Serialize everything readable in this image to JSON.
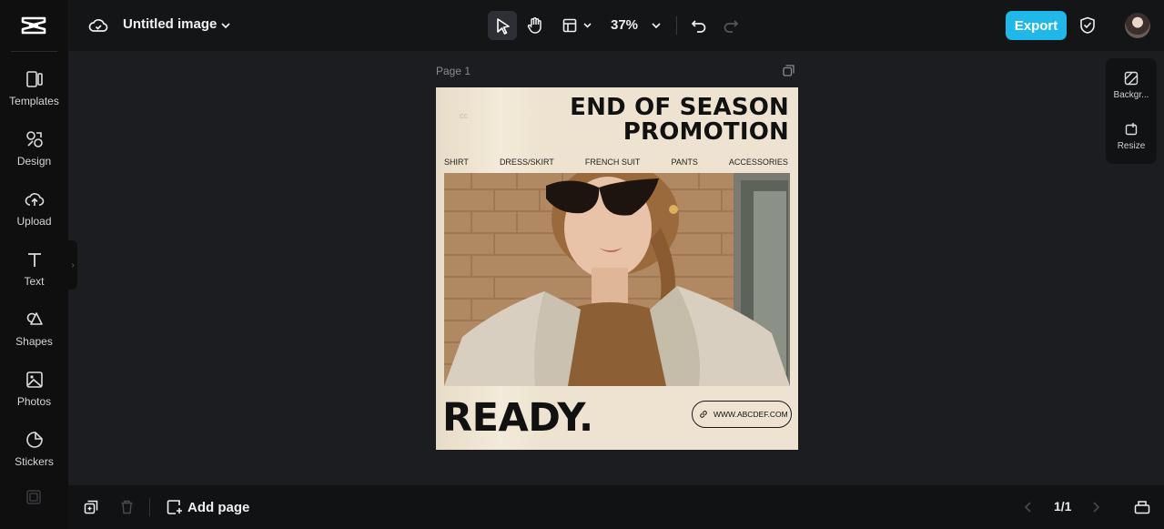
{
  "app": {
    "brand_icon": "capcut-logo-icon"
  },
  "sidebar": {
    "items": [
      {
        "label": "Templates",
        "icon": "templates-icon"
      },
      {
        "label": "Design",
        "icon": "design-icon"
      },
      {
        "label": "Upload",
        "icon": "upload-icon"
      },
      {
        "label": "Text",
        "icon": "text-icon"
      },
      {
        "label": "Shapes",
        "icon": "shapes-icon"
      },
      {
        "label": "Photos",
        "icon": "photos-icon"
      },
      {
        "label": "Stickers",
        "icon": "stickers-icon"
      }
    ]
  },
  "topbar": {
    "doc_title": "Untitled image",
    "zoom": "37%",
    "export_label": "Export"
  },
  "canvas": {
    "page_label": "Page 1",
    "design": {
      "corner_mark": "cc",
      "title_line1": "END OF SEASON",
      "title_line2": "PROMOTION",
      "categories": [
        "SHIRT",
        "DRESS/SKIRT",
        "FRENCH SUIT",
        "PANTS",
        "ACCESSORIES"
      ],
      "headline": "READY.",
      "url": "WWW.ABCDEF.COM"
    }
  },
  "right_panel": {
    "background_label": "Backgr...",
    "resize_label": "Resize"
  },
  "bottombar": {
    "add_page_label": "Add page",
    "pager": "1/1"
  },
  "colors": {
    "accent": "#20b8e8",
    "canvas_bg": "#1c1d21",
    "sidebar_bg": "#0f0f10",
    "design_bg": "#ede3d0"
  }
}
